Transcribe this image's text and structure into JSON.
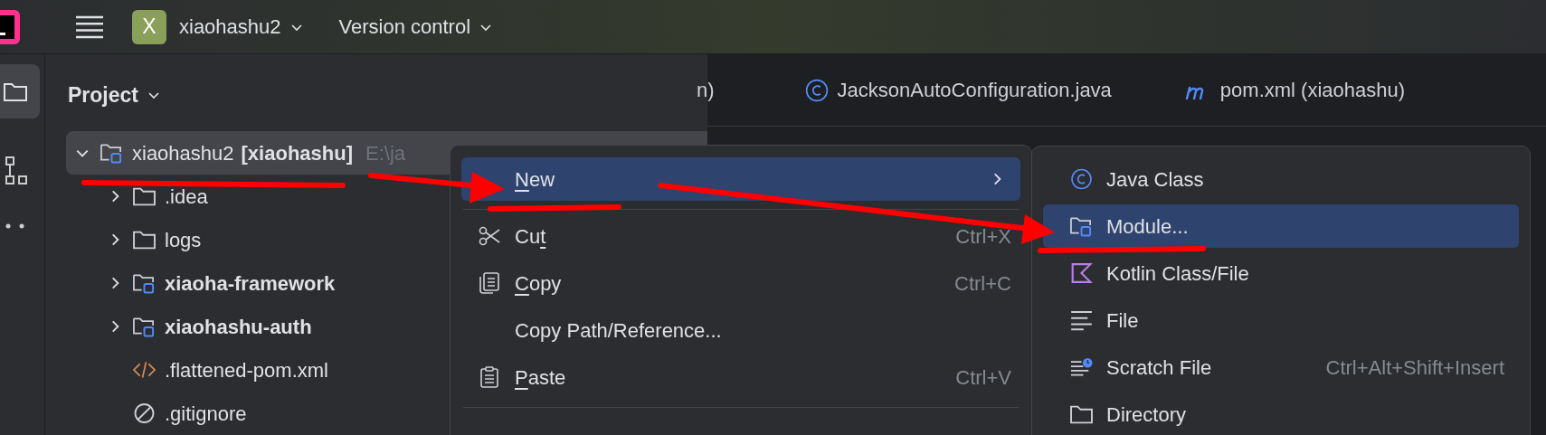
{
  "title_bar": {
    "project_badge": "X",
    "project": "xiaohashu2",
    "vcs": "Version control"
  },
  "project_panel": {
    "title": "Project",
    "tree": [
      {
        "label": "xiaohashu2",
        "module": "[xiaohashu]",
        "path": "E:\\ja",
        "kind": "module",
        "expanded": true,
        "selected": true,
        "children": [
          {
            "label": ".idea",
            "kind": "folder",
            "expanded": false,
            "selected": false
          },
          {
            "label": "logs",
            "kind": "folder",
            "expanded": false,
            "selected": false
          },
          {
            "label": "xiaoha-framework",
            "kind": "module",
            "expanded": false,
            "selected": false
          },
          {
            "label": "xiaohashu-auth",
            "kind": "module",
            "expanded": false,
            "selected": false
          },
          {
            "label": ".flattened-pom.xml",
            "kind": "xml",
            "selected": false
          },
          {
            "label": ".gitignore",
            "kind": "ignore",
            "selected": false
          }
        ]
      }
    ]
  },
  "editor_tabs": [
    {
      "label": "n)",
      "kind": "plain"
    },
    {
      "label": "JacksonAutoConfiguration.java",
      "kind": "class"
    },
    {
      "label": "pom.xml (xiaohashu)",
      "kind": "maven"
    }
  ],
  "context_menu": [
    {
      "kind": "new",
      "key": "N",
      "post": "ew",
      "submenu": true,
      "selected": true
    },
    {
      "kind": "separator"
    },
    {
      "kind": "cut",
      "pre": "Cu",
      "key": "t",
      "shortcut": "Ctrl+X",
      "submenu": false,
      "selected": false
    },
    {
      "kind": "copy",
      "key": "C",
      "post": "opy",
      "shortcut": "Ctrl+C",
      "submenu": false,
      "selected": false
    },
    {
      "kind": "copy_path",
      "pre": "Copy Path/Reference...",
      "submenu": false,
      "selected": false
    },
    {
      "kind": "paste",
      "key": "P",
      "post": "aste",
      "shortcut": "Ctrl+V",
      "submenu": false,
      "selected": false
    },
    {
      "kind": "separator"
    }
  ],
  "new_submenu": [
    {
      "label": "Java Class",
      "kind": "class",
      "selected": false
    },
    {
      "label": "Module...",
      "kind": "module",
      "selected": true
    },
    {
      "label": "Kotlin Class/File",
      "kind": "kotlin",
      "selected": false
    },
    {
      "label": "File",
      "kind": "file",
      "selected": false
    },
    {
      "label": "Scratch File",
      "kind": "scratch",
      "shortcut": "Ctrl+Alt+Shift+Insert",
      "selected": false
    },
    {
      "label": "Directory",
      "kind": "folder",
      "selected": false
    }
  ]
}
